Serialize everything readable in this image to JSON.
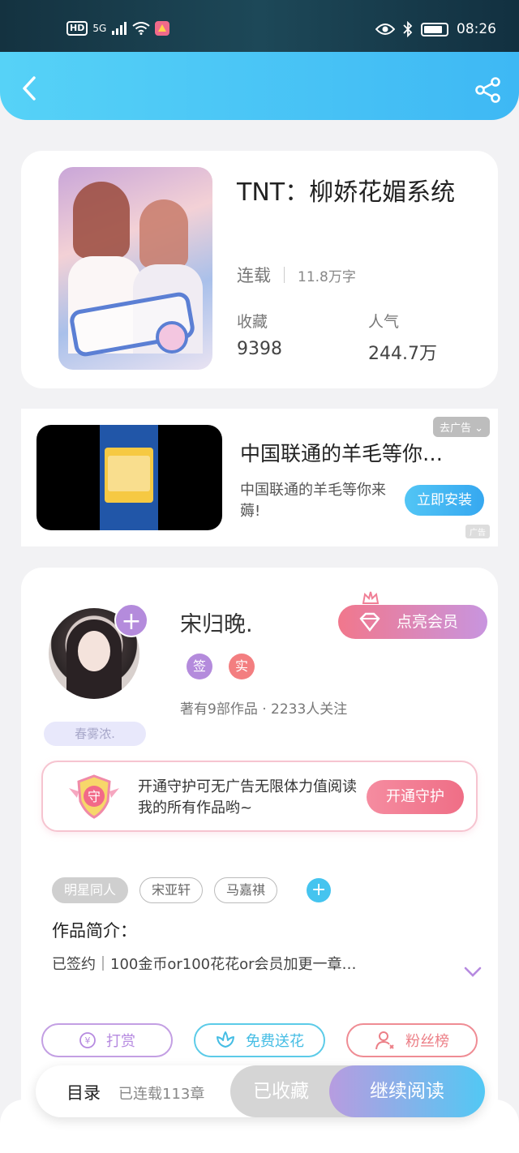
{
  "status_bar": {
    "hd": "HD",
    "network": "5G",
    "time": "08:26"
  },
  "header": {
    "back_icon": "chevron-left-icon",
    "share_icon": "share-icon"
  },
  "book": {
    "title": "TNT：柳娇花媚系统",
    "status": "连载",
    "word_count": "11.8万字",
    "favorites_label": "收藏",
    "favorites_value": "9398",
    "popularity_label": "人气",
    "popularity_value": "244.7万"
  },
  "ad": {
    "close_label": "去广告",
    "title": "中国联通的羊毛等你…",
    "description": "中国联通的羊毛等你来薅!",
    "install_label": "立即安装",
    "ad_mark": "广告"
  },
  "author": {
    "name": "宋归晚.",
    "follow_icon": "plus-icon",
    "badge_signed": "签",
    "badge_verified": "实",
    "works": "著有9部作品",
    "followers": "2233人关注",
    "meta_separator": "·",
    "fan_tag": "春雾浓.",
    "vip_label": "点亮会员"
  },
  "guard": {
    "shield_char": "守",
    "text": "开通守护可无广告无限体力值阅读我的所有作品哟~",
    "button_label": "开通守护"
  },
  "tags": [
    "明星同人",
    "宋亚轩",
    "马嘉祺"
  ],
  "intro": {
    "title": "作品简介：",
    "text": "已签约｜100金币or100花花or会员加更一章…"
  },
  "actions": {
    "tip_label": "打赏",
    "tip_symbol": "¥",
    "flower_label": "免费送花",
    "fans_label": "粉丝榜"
  },
  "bottom_bar": {
    "toc_label": "目录",
    "chapter_count": "已连载113章",
    "collected_label": "已收藏",
    "read_label": "继续阅读"
  },
  "colors": {
    "header": "#3eb8f4",
    "accent_purple": "#b48bdc",
    "accent_pink": "#ef6e86",
    "accent_cyan": "#45c4ef"
  }
}
